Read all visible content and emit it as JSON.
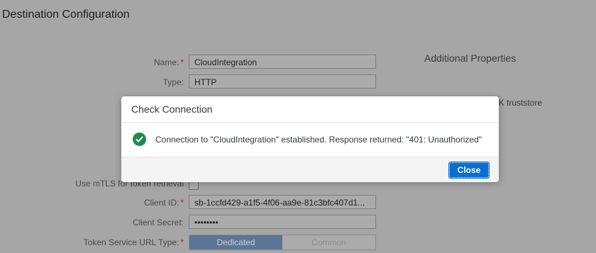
{
  "page": {
    "title": "Destination Configuration"
  },
  "form": {
    "name_label": "Name:",
    "name_value": "CloudIntegration",
    "type_label": "Type:",
    "type_value": "HTTP",
    "mtls_label": "Use mTLS for token retrieval",
    "client_id_label": "Client ID:",
    "client_id_value": "sb-1ccfd429-a1f5-4f06-aa9e-81c3bfc407d1...",
    "client_secret_label": "Client Secret:",
    "client_secret_value": "••••••••",
    "token_url_type_label": "Token Service URL Type:",
    "token_url_type_options": [
      "Dedicated",
      "Common"
    ],
    "required_marker": "*"
  },
  "side": {
    "heading": "Additional Properties",
    "partial_text": "DK truststore"
  },
  "dialog": {
    "title": "Check Connection",
    "message": "Connection to \"CloudIntegration\" established. Response returned: \"401: Unauthorized\"",
    "close_label": "Close"
  },
  "colors": {
    "success": "#1f8a4c",
    "primary": "#0a6ed1",
    "required": "#a51e1e"
  }
}
